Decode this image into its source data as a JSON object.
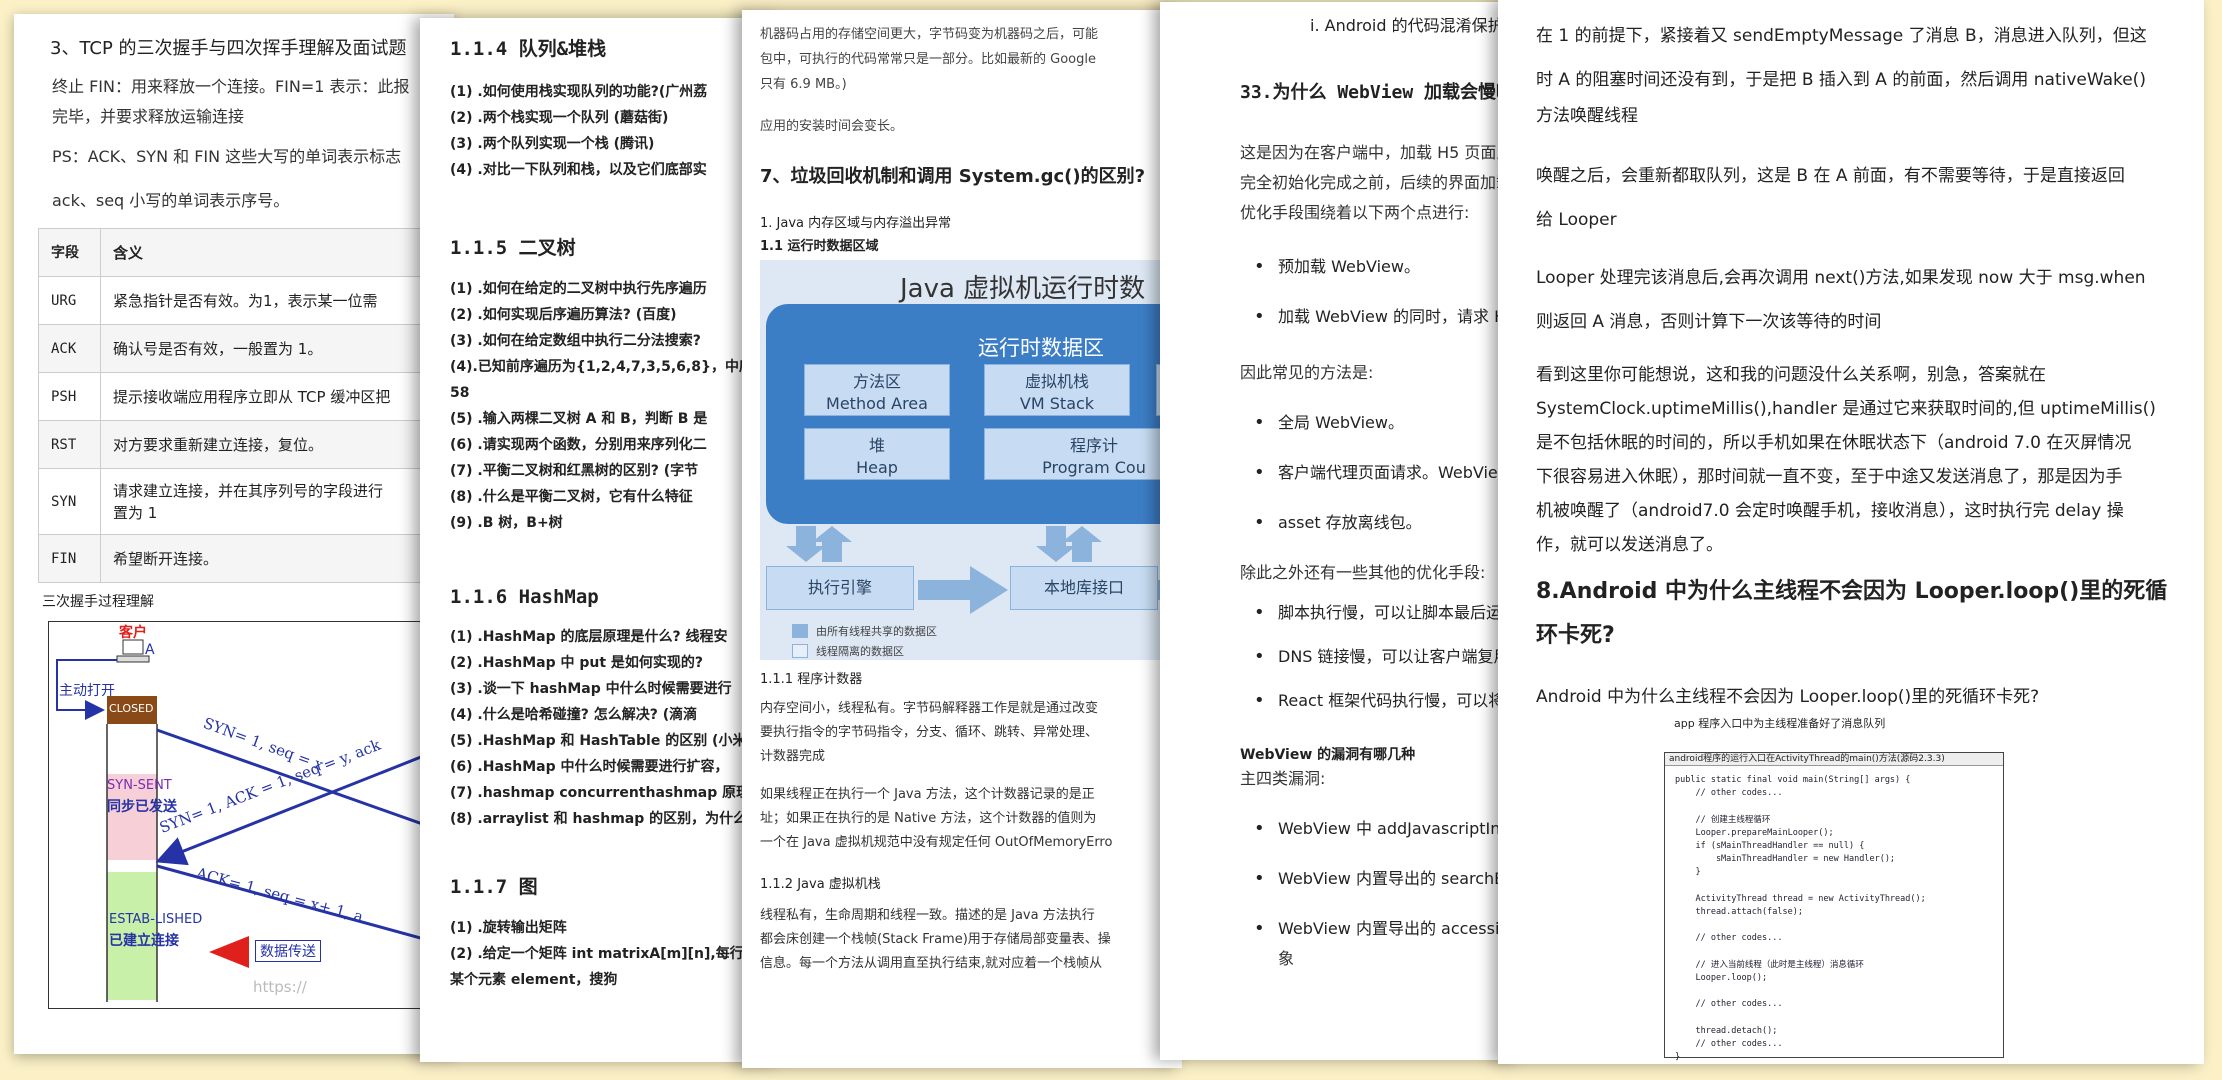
{
  "page1": {
    "heading": "3、TCP 的三次握手与四次挥手理解及面试题",
    "lines": [
      "终止 FIN：用来释放一个连接。FIN=1 表示：此报",
      "完毕，并要求释放运输连接",
      "PS：ACK、SYN 和 FIN 这些大写的单词表示标志",
      "ack、seq 小写的单词表示序号。"
    ],
    "table_header": [
      "字段",
      "含义"
    ],
    "table_rows": [
      [
        "URG",
        "紧急指针是否有效。为1，表示某一位需"
      ],
      [
        "ACK",
        "确认号是否有效，一般置为 1。"
      ],
      [
        "PSH",
        "提示接收端应用程序立即从 TCP 缓冲区把"
      ],
      [
        "RST",
        "对方要求重新建立连接，复位。"
      ],
      [
        "SYN",
        "请求建立连接，并在其序列号的字段进行",
        "置为 1"
      ],
      [
        "FIN",
        "希望断开连接。"
      ]
    ],
    "caption": "三次握手过程理解",
    "diagram": {
      "client": "客户",
      "a": "A",
      "active_open": "主动打开",
      "closed": "CLOSED",
      "syn_sent": "SYN-SENT",
      "syn_sent_cn": "同步已发送",
      "established": "ESTAB-LISHED",
      "established_cn": "已建立连接",
      "data_transfer": "数据传送",
      "msg1": "SYN= 1, seq = x",
      "msg2": "SYN= 1, ACK = 1, seq = y, ack",
      "msg3": "ACK= 1, seq = x+ 1, a",
      "watermark": "https://"
    }
  },
  "page2": {
    "s1": "1.1.4 队列&堆栈",
    "q1": [
      "(1) .如何使用栈实现队列的功能?(广州荔",
      "(2) .两个栈实现一个队列 (蘑菇街)",
      "(3) .两个队列实现一个栈 (腾讯)",
      "(4) .对比一下队列和栈，以及它们底部实"
    ],
    "s2": "1.1.5 二叉树",
    "q2": [
      "(1) .如何在给定的二叉树中执行先序遍历",
      "(2) .如何实现后序遍历算法? (百度)",
      "(3) .如何在给定数组中执行二分法搜索?",
      "(4).已知前序遍历为{1,2,4,7,3,5,6,8}，中序",
      "58",
      "(5) .输入两棵二叉树 A 和 B，判断 B 是",
      "(6) .请实现两个函数，分别用来序列化二",
      "(7) .平衡二叉树和红黑树的区别? (字节",
      "(8) .什么是平衡二叉树，它有什么特征",
      "(9) .B 树，B+树"
    ],
    "s3": "1.1.6 HashMap",
    "q3": [
      "(1) .HashMap 的底层原理是什么? 线程安",
      "(2) .HashMap 中 put 是如何实现的?",
      "(3) .谈一下 hashMap 中什么时候需要进行",
      "(4) .什么是哈希碰撞? 怎么解决? (滴滴",
      "(5) .HashMap 和 HashTable 的区别 (小米",
      "(6) .HashMap 中什么时候需要进行扩容，",
      "(7) .hashmap concurrenthashmap 原理",
      "(8) .arraylist 和 hashmap 的区别，为什么"
    ],
    "s4": "1.1.7 图",
    "q4": [
      "(1) .旋转输出矩阵",
      "(2) .给定一个矩阵 int matrixA[m][n],每行",
      "某个元素 element，搜狗"
    ]
  },
  "page3": {
    "top": [
      "机器码占用的存储空间更大，字节码变为机器码之后，可能",
      "包中，可执行的代码常常只是一部分。比如最新的 Google",
      "只有 6.9 MB。)"
    ],
    "note": "应用的安装时间会变长。",
    "heading": "7、垃圾回收机制和调用 System.gc()的区别?",
    "sub1": "1. Java 内存区域与内存溢出异常",
    "sub2": "1.1 运行时数据区域",
    "jvm": {
      "title": "Java 虚拟机运行时数",
      "area": "运行时数据区",
      "method_cn": "方法区",
      "method_en": "Method Area",
      "stack_cn": "虚拟机栈",
      "stack_en": "VM Stack",
      "heap_cn": "堆",
      "heap_en": "Heap",
      "pc_cn": "程序计",
      "pc_en": "Program Cou",
      "engine": "执行引擎",
      "native": "本地库接口",
      "legend_shared": "由所有线程共享的数据区",
      "legend_private": "线程隔离的数据区"
    },
    "s_pc": "1.1.1 程序计数器",
    "pc_text": [
      "内存空间小，线程私有。字节码解释器工作是就是通过改变",
      "要执行指令的字节码指令，分支、循环、跳转、异常处理、",
      "计数器完成",
      "",
      "如果线程正在执行一个 Java 方法，这个计数器记录的是正",
      "址；如果正在执行的是 Native 方法，这个计数器的值则为",
      "一个在 Java 虚拟机规范中没有规定任何 OutOfMemoryErro"
    ],
    "s_stack": "1.1.2 Java 虚拟机栈",
    "stack_text": [
      "线程私有，生命周期和线程一致。描述的是 Java 方法执行",
      "都会床创建一个栈帧(Stack Frame)用于存储局部变量表、操",
      "信息。每一个方法从调用直至执行结束,就对应着一个栈帧从"
    ]
  },
  "page4": {
    "top": "i.   Android 的代码混淆保护",
    "heading": "33.为什么 WebView 加载会慢呢?",
    "p1": [
      "这是因为在客户端中，加载 H5 页面之前",
      "完全初始化完成之前，后续的界面加载",
      "优化手段围绕着以下两个点进行:"
    ],
    "b1": [
      "预加载 WebView。",
      "加载 WebView 的同时，请求 H5"
    ],
    "p2": "因此常见的方法是:",
    "b2": [
      "全局 WebView。",
      "客户端代理页面请求。WebView",
      "asset 存放离线包。"
    ],
    "p3": "除此之外还有一些其他的优化手段:",
    "b3": [
      "脚本执行慢，可以让脚本最后运",
      "DNS 链接慢，可以让客户端复用",
      "React 框架代码执行慢，可以将"
    ],
    "h2": "WebView 的漏洞有哪几种",
    "p4": "主四类漏洞:",
    "b4": [
      "WebView 中 addJavascriptInte",
      "WebView 内置导出的 searchBo",
      "WebView 内置导出的 accessi"
    ],
    "b4_tail": "象"
  },
  "page5": {
    "l1": [
      "在 1 的前提下，紧接着又 sendEmptyMessage 了消息 B，消息进入队列，但这",
      "时 A 的阻塞时间还没有到，于是把 B 插入到 A 的前面，然后调用 nativeWake()",
      "方法唤醒线程"
    ],
    "l2": [
      "唤醒之后，会重新都取队列，这是 B 在 A 前面，有不需要等待，于是直接返回",
      "给 Looper"
    ],
    "l3": [
      "Looper 处理完该消息后,会再次调用 next()方法,如果发现 now 大于 msg.when",
      "则返回 A 消息，否则计算下一次该等待的时间"
    ],
    "l4": [
      "看到这里你可能想说，这和我的问题没什么关系啊，别急，答案就在",
      "SystemClock.uptimeMillis(),handler 是通过它来获取时间的,但 uptimeMillis()",
      "是不包括休眠的时间的，所以手机如果在休眠状态下（android 7.0 在灭屏情况",
      "下很容易进入休眠），那时间就一直不变，至于中途又发送消息了，那是因为手",
      "机被唤醒了（android7.0 会定时唤醒手机，接收消息），这时执行完 delay 操",
      "作，就可以发送消息了。"
    ],
    "heading": [
      "8.Android 中为什么主线程不会因为 Looper.loop()里的死循",
      "环卡死?"
    ],
    "question": "Android 中为什么主线程不会因为 Looper.loop()里的死循环卡死?",
    "caption": "app 程序入口中为主线程准备好了消息队列",
    "code_bar": "android程序的运行入口在ActivityThread的main()方法(源码2.3.3)",
    "code": "public static final void main(String[] args) {\n    // other codes...\n\n    // 创建主线程循环\n    Looper.prepareMainLooper();\n    if (sMainThreadHandler == null) {\n        sMainThreadHandler = new Handler();\n    }\n\n    ActivityThread thread = new ActivityThread();\n    thread.attach(false);\n\n    // other codes...\n\n    // 进入当前线程（此时是主线程）消息循环\n    Looper.loop();\n\n    // other codes...\n\n    thread.detach();\n    // other codes...\n}"
  },
  "colors": {
    "background": "#fbf0c6",
    "jvm_blue": "#3c7ec6",
    "tcp_arrow": "#2633a6",
    "closed_box": "#8a4a17",
    "syn_sent_box": "#f6d0d6",
    "established_box": "#c8f0a8",
    "data_arrow": "#e0201c"
  }
}
